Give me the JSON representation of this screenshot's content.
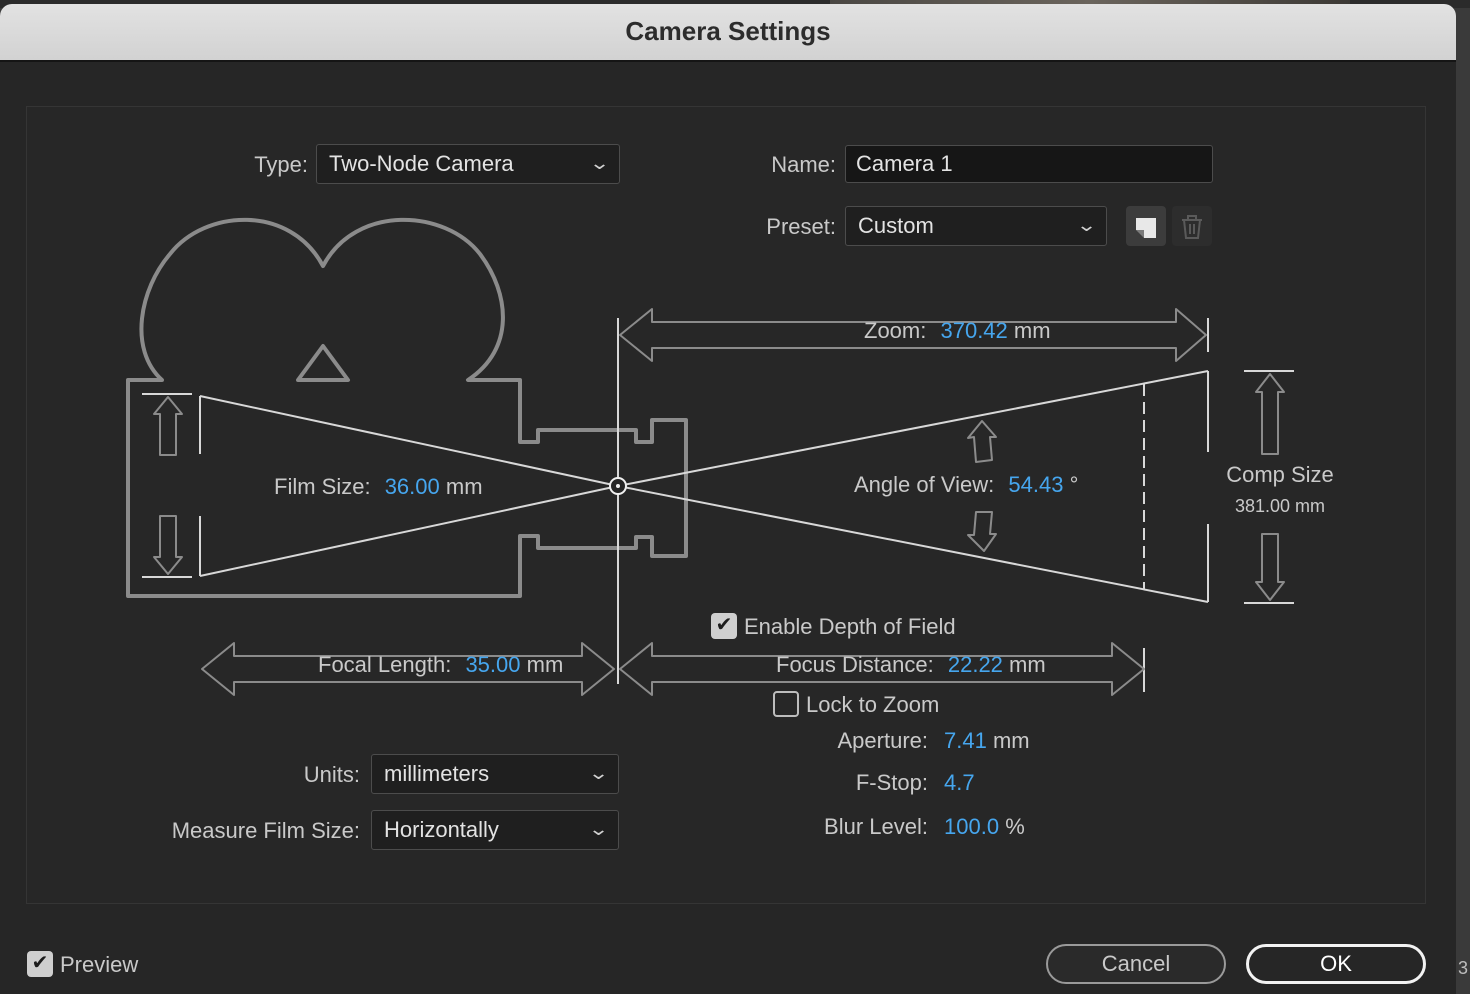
{
  "dialog": {
    "title": "Camera Settings"
  },
  "type": {
    "label": "Type:",
    "value": "Two-Node Camera"
  },
  "name": {
    "label": "Name:",
    "value": "Camera 1"
  },
  "preset": {
    "label": "Preset:",
    "value": "Custom"
  },
  "zoom": {
    "label": "Zoom:",
    "value": "370.42",
    "unit": "mm"
  },
  "comp_size": {
    "label": "Comp Size",
    "value": "381.00 mm"
  },
  "film_size": {
    "label": "Film Size:",
    "value": "36.00",
    "unit": "mm"
  },
  "angle_of_view": {
    "label": "Angle of View:",
    "value": "54.43",
    "unit": "°"
  },
  "depth_of_field": {
    "label": "Enable Depth of Field",
    "checked": true
  },
  "focal_length": {
    "label": "Focal Length:",
    "value": "35.00",
    "unit": "mm"
  },
  "focus_distance": {
    "label": "Focus Distance:",
    "value": "22.22",
    "unit": "mm"
  },
  "lock_to_zoom": {
    "label": "Lock to Zoom",
    "checked": false
  },
  "aperture": {
    "label": "Aperture:",
    "value": "7.41",
    "unit": "mm"
  },
  "fstop": {
    "label": "F-Stop:",
    "value": "4.7"
  },
  "blur_level": {
    "label": "Blur Level:",
    "value": "100.0",
    "unit": "%"
  },
  "units": {
    "label": "Units:",
    "value": "millimeters"
  },
  "measure_film_size": {
    "label": "Measure Film Size:",
    "value": "Horizontally"
  },
  "preview": {
    "label": "Preview",
    "checked": true
  },
  "buttons": {
    "cancel": "Cancel",
    "ok": "OK"
  },
  "corner_text": "3",
  "colors": {
    "value_accent": "#46a6ee",
    "title_bar": "#d8d8d8",
    "dialog_bg": "#262626"
  },
  "icons": {
    "save_preset": "save-preset-icon",
    "delete_preset": "trash-icon",
    "dropdown": "chevron-down-icon",
    "check": "checkmark-icon"
  }
}
